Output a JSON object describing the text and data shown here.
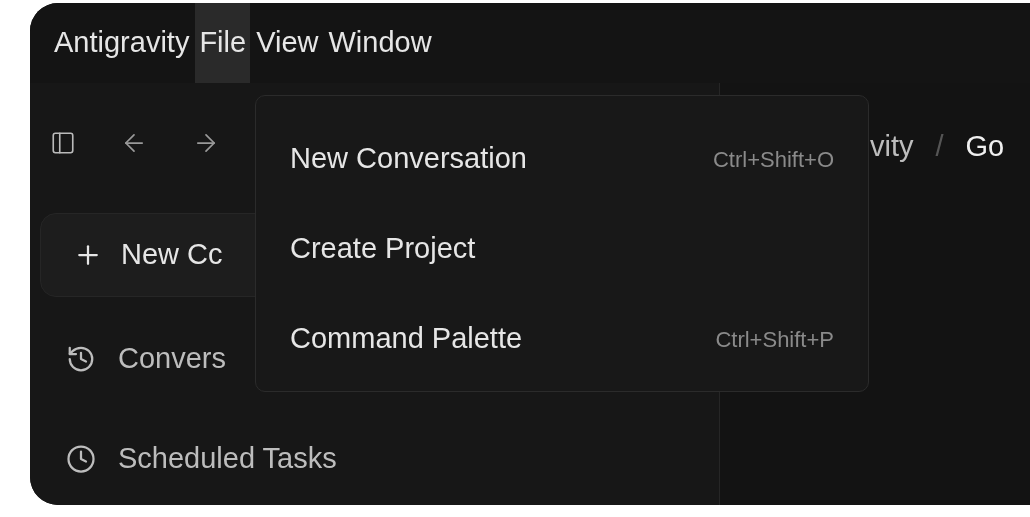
{
  "menubar": [
    {
      "label": "Antigravity",
      "selected": false
    },
    {
      "label": "File",
      "selected": true
    },
    {
      "label": "View",
      "selected": false
    },
    {
      "label": "Window",
      "selected": false
    }
  ],
  "sidebar": {
    "new_button": "New Cc",
    "items": [
      {
        "kind": "history",
        "label": "Convers"
      },
      {
        "kind": "scheduled",
        "label": "Scheduled Tasks"
      }
    ]
  },
  "breadcrumb": [
    "vity",
    "/",
    "Go"
  ],
  "file_menu": [
    {
      "label": "New Conversation",
      "shortcut": "Ctrl+Shift+O"
    },
    {
      "label": "Create Project"
    },
    {
      "label": "Command Palette",
      "shortcut": "Ctrl+Shift+P"
    }
  ]
}
